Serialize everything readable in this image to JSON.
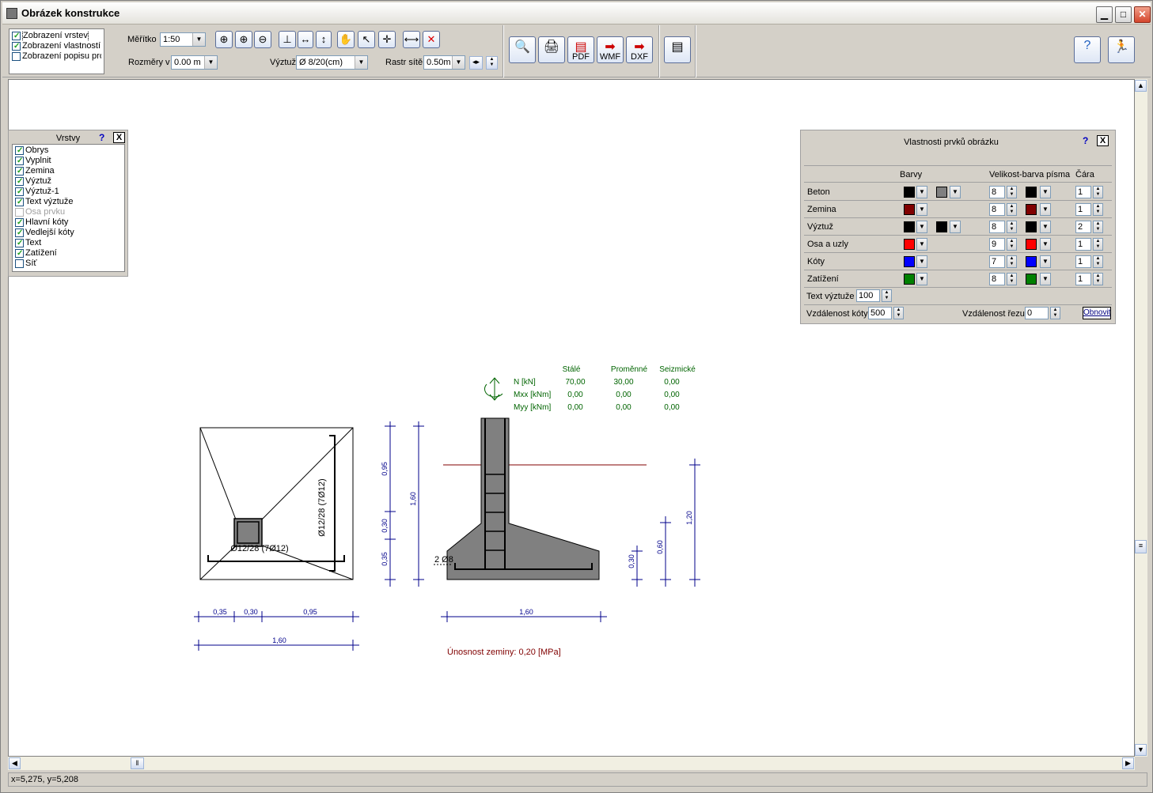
{
  "window": {
    "title": "Obrázek konstrukce"
  },
  "toolbar": {
    "display_checks": [
      {
        "label": "Zobrazení vrstev",
        "checked": true
      },
      {
        "label": "Zobrazení vlastností",
        "checked": true
      },
      {
        "label": "Zobrazení popisu pro",
        "checked": false
      }
    ],
    "scale_label": "Měřítko",
    "scale_value": "1:50",
    "dims_label": "Rozměry v",
    "dims_value": "0.00 m",
    "rebar_label": "Výztuž",
    "rebar_value": "Ø 8/20(cm)",
    "grid_label": "Rastr sítě",
    "grid_value": "0.50m",
    "pdf": "PDF",
    "wmf": "WMF",
    "dxf": "DXF"
  },
  "layers_panel": {
    "title": "Vrstvy",
    "help": "?",
    "close": "X",
    "items": [
      {
        "label": "Obrys",
        "checked": true,
        "enabled": true
      },
      {
        "label": "Vyplnit",
        "checked": true,
        "enabled": true
      },
      {
        "label": "Zemina",
        "checked": true,
        "enabled": true
      },
      {
        "label": "Výztuž",
        "checked": true,
        "enabled": true
      },
      {
        "label": "Výztuž-1",
        "checked": true,
        "enabled": true
      },
      {
        "label": "Text výztuže",
        "checked": true,
        "enabled": true
      },
      {
        "label": "Osa prvku",
        "checked": false,
        "enabled": false
      },
      {
        "label": "Hlavní kóty",
        "checked": true,
        "enabled": true
      },
      {
        "label": "Vedlejší kóty",
        "checked": true,
        "enabled": true
      },
      {
        "label": "Text",
        "checked": true,
        "enabled": true
      },
      {
        "label": "Zatížení",
        "checked": true,
        "enabled": true
      },
      {
        "label": "Síť",
        "checked": false,
        "enabled": true
      }
    ]
  },
  "props_panel": {
    "title": "Vlastnosti prvků obrázku",
    "help": "?",
    "close": "X",
    "col_colors": "Barvy",
    "col_font": "Velikost-barva písma",
    "col_line": "Čára",
    "rows": [
      {
        "name": "Beton",
        "c1": "#000000",
        "c2": "#808080",
        "size": "8",
        "fc": "#000000",
        "line": "1"
      },
      {
        "name": "Zemina",
        "c1": "#800000",
        "c2": null,
        "size": "8",
        "fc": "#800000",
        "line": "1"
      },
      {
        "name": "Výztuž",
        "c1": "#000000",
        "c2": "#000000",
        "size": "8",
        "fc": "#000000",
        "line": "2"
      },
      {
        "name": "Osa a uzly",
        "c1": "#ff0000",
        "c2": null,
        "size": "9",
        "fc": "#ff0000",
        "line": "1"
      },
      {
        "name": "Kóty",
        "c1": "#0000ff",
        "c2": null,
        "size": "7",
        "fc": "#0000ff",
        "line": "1"
      },
      {
        "name": "Zatížení",
        "c1": "#008000",
        "c2": null,
        "size": "8",
        "fc": "#008000",
        "line": "1"
      }
    ],
    "rebar_text_label": "Text výztuže",
    "rebar_text_value": "100",
    "dim_dist_label": "Vzdálenost kóty",
    "dim_dist_value": "500",
    "cut_dist_label": "Vzdálenost řezu",
    "cut_dist_value": "0",
    "refresh": "Obnovit"
  },
  "drawing": {
    "loads": {
      "headers": [
        "Stálé",
        "Proměnné",
        "Seizmické"
      ],
      "rows": [
        {
          "label": "N   [kN]",
          "values": [
            "70,00",
            "30,00",
            "0,00"
          ]
        },
        {
          "label": "Mxx [kNm]",
          "values": [
            "0,00",
            "0,00",
            "0,00"
          ]
        },
        {
          "label": "Myy [kNm]",
          "values": [
            "0,00",
            "0,00",
            "0,00"
          ]
        }
      ]
    },
    "plan_rebar_v": "Ø12/28 (7Ø12)",
    "plan_rebar_h": "Ø12/28 (7Ø12)",
    "plan_dims": [
      "0,35",
      "0,30",
      "0,95"
    ],
    "plan_total": "1,60",
    "section_vdims": [
      "0,95",
      "0,30",
      "0,35"
    ],
    "section_total_h": "1,60",
    "section_rebar": "2 Ø8",
    "section_width": "1,60",
    "soil_dims": [
      "0,30",
      "0,60",
      "1,20"
    ],
    "bearing": "Únosnost zeminy: 0,20  [MPa]"
  },
  "status": {
    "coords": "x=5,275, y=5,208"
  },
  "colors": {
    "dim": "#00008b",
    "load": "#006400",
    "soil": "#800000",
    "concrete": "#808080"
  }
}
